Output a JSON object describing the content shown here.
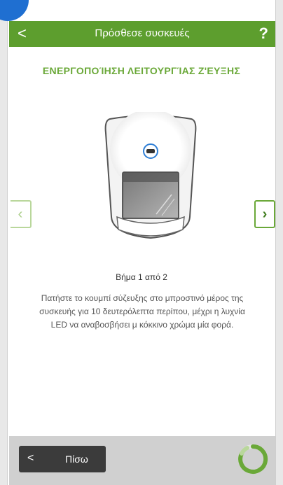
{
  "header": {
    "back_glyph": "<",
    "title": "Πρόσθεσε συσκευές",
    "help_glyph": "?"
  },
  "section_title": "ΕΝΕΡΓΟΠΟΊΗΣΗ ΛΕΙΤΟΥΡΓΊΑΣ Ζ'ΕΥΞΗΣ",
  "nav": {
    "prev_glyph": "‹",
    "next_glyph": "›"
  },
  "step_label": "Βήμα 1 από 2",
  "instructions": "Πατήστε το κουμπί σύζευξης στο μπροστινό μέρος της συσκευής για 10 δευτερόλεπτα περίπου, μέχρι η λυχνία LED να αναβοσβήσει μ κόκκινο χρώμα μία φορά.",
  "footer": {
    "back_glyph": "<",
    "back_label": "Πίσω"
  },
  "icons": {
    "device_illustration": "motion-sensor-device",
    "spinner": "loading-spinner-icon"
  },
  "colors": {
    "header_bg": "#5d9e2e",
    "accent_green": "#6aa838",
    "footer_bg": "#d0d0d0",
    "button_dark": "#3b3b3b",
    "pairing_button_blue": "#2f7fd6"
  }
}
